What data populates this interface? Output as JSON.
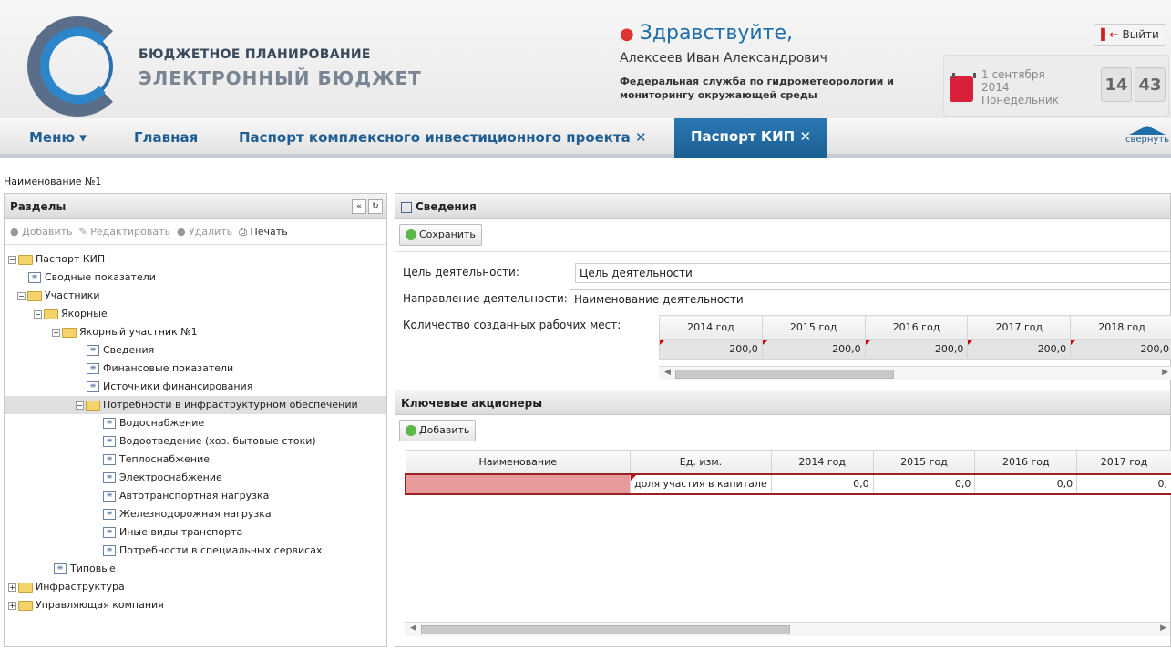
{
  "header": {
    "logo_line1": "БЮДЖЕТНОЕ ПЛАНИРОВАНИЕ",
    "logo_line2": "ЭЛЕКТРОННЫЙ БЮДЖЕТ",
    "greeting": "Здравствуйте,",
    "user_name": "Алексеев Иван Александрович",
    "organization": "Федеральная служба по гидрометеорологии и мониторингу окружающей среды",
    "date_line1": "1 сентября",
    "date_line2": "2014",
    "date_line3": "Понедельник",
    "hours": "14",
    "minutes": "43",
    "logout_label": "Выйти"
  },
  "nav": {
    "menu": "Меню ▾",
    "home": "Главная",
    "tab1": "Паспорт комплексного инвестиционного проекта",
    "tab_active": "Паспорт КИП ✕",
    "close": "✕",
    "collapse": "свернуть"
  },
  "breadcrumb": "Наименование №1",
  "left": {
    "title": "Разделы",
    "add": "Добавить",
    "edit": "Редактировать",
    "delete": "Удалить",
    "print": "Печать",
    "tree": [
      {
        "label": "Паспорт КИП",
        "type": "folder",
        "pm": "−"
      },
      {
        "label": "Сводные показатели",
        "type": "doc"
      },
      {
        "label": "Участники",
        "type": "folder",
        "pm": "−"
      },
      {
        "label": "Якорные",
        "type": "folder",
        "pm": "−"
      },
      {
        "label": "Якорный участник №1",
        "type": "folder",
        "pm": "−"
      },
      {
        "label": "Сведения",
        "type": "doc"
      },
      {
        "label": "Финансовые показатели",
        "type": "doc"
      },
      {
        "label": "Источники финансирования",
        "type": "doc"
      },
      {
        "label": "Потребности в инфраструктурном обеспечении",
        "type": "folder",
        "pm": "−"
      },
      {
        "label": "Водоснабжение",
        "type": "doc"
      },
      {
        "label": "Водоотведение (хоз. бытовые стоки)",
        "type": "doc"
      },
      {
        "label": "Теплоснабжение",
        "type": "doc"
      },
      {
        "label": "Электроснабжение",
        "type": "doc"
      },
      {
        "label": "Автотранспортная нагрузка",
        "type": "doc"
      },
      {
        "label": "Железнодорожная нагрузка",
        "type": "doc"
      },
      {
        "label": "Иные виды транспорта",
        "type": "doc"
      },
      {
        "label": "Потребности в специальных сервисах",
        "type": "doc"
      },
      {
        "label": "Типовые",
        "type": "doc"
      },
      {
        "label": "Инфраструктура",
        "type": "folder",
        "pm": "+"
      },
      {
        "label": "Управляющая компания",
        "type": "folder",
        "pm": "+"
      }
    ]
  },
  "right": {
    "title": "Сведения",
    "save": "Сохранить",
    "goal_label": "Цель деятельности:",
    "goal_value": "Цель деятельности",
    "direction_label": "Направление деятельности:",
    "direction_value": "Наименование деятельности",
    "jobs_label": "Количество созданных рабочих мест:",
    "years": [
      "2014 год",
      "2015 год",
      "2016 год",
      "2017 год",
      "2018 год"
    ],
    "jobs_values": [
      "200,0",
      "200,0",
      "200,0",
      "200,0",
      "200,0"
    ],
    "shareholders_title": "Ключевые акционеры",
    "add": "Добавить",
    "sh_headers": [
      "Наименование",
      "Ед. изм.",
      "2014 год",
      "2015 год",
      "2016 год",
      "2017 год"
    ],
    "sh_row": [
      "",
      "доля участия в капитале",
      "0,0",
      "0,0",
      "0,0",
      "0,"
    ]
  }
}
